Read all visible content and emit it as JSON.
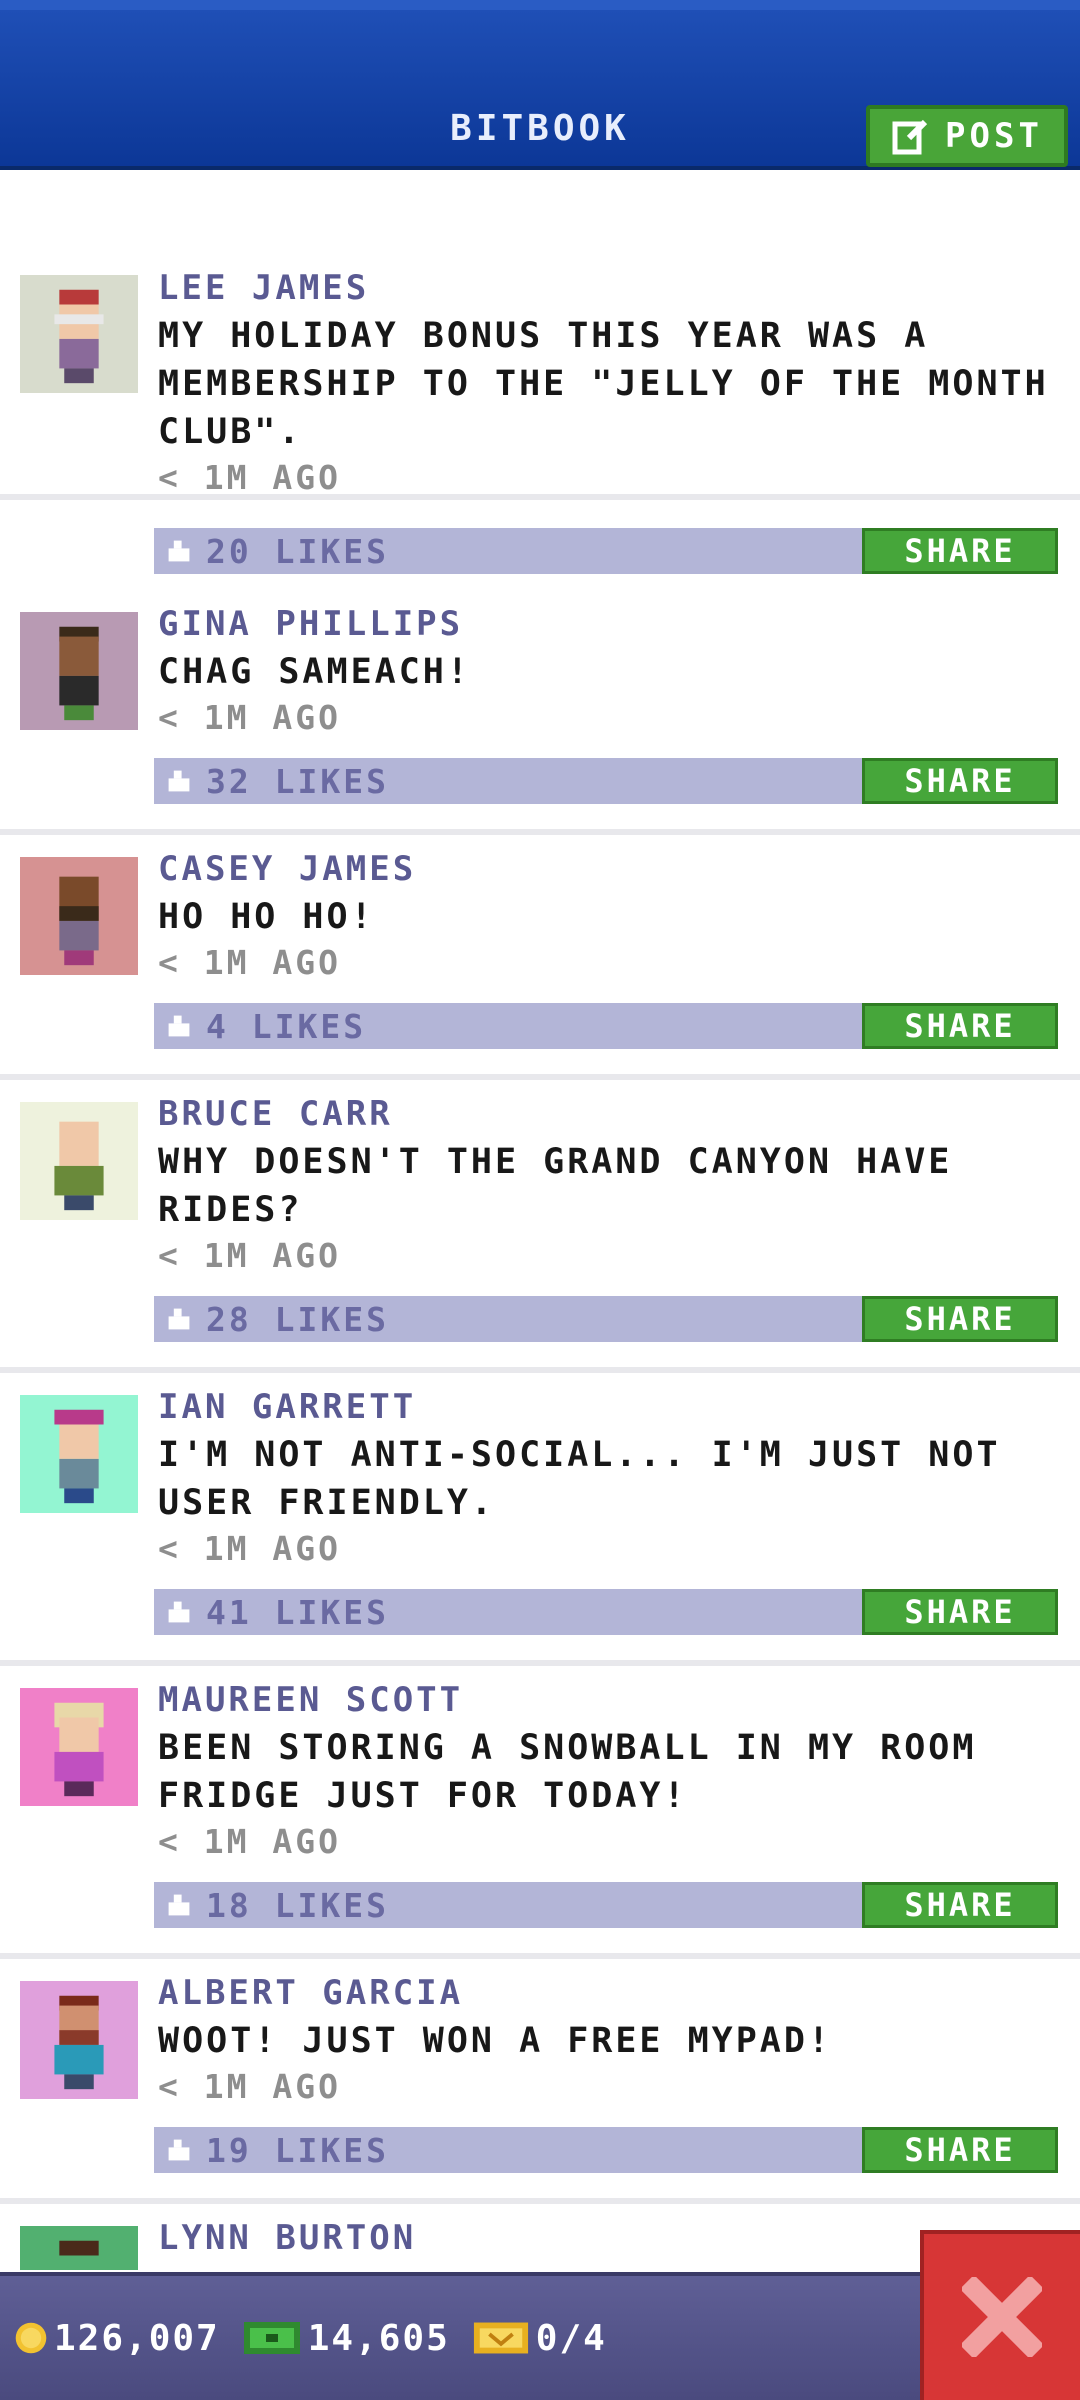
{
  "header": {
    "title": "BITBOOK",
    "post_label": "POST"
  },
  "posts": [
    {
      "name": "LEE JAMES",
      "text": "MY HOLIDAY BONUS THIS YEAR WAS A MEMBERSHIP TO THE \"JELLY OF THE MONTH CLUB\".",
      "time": "< 1M AGO",
      "likes": "20 LIKES",
      "share": "SHARE",
      "avatar_bg": "#d8dccd"
    },
    {
      "name": "GINA PHILLIPS",
      "text": "CHAG SAMEACH!",
      "time": "< 1M AGO",
      "likes": "32 LIKES",
      "share": "SHARE",
      "avatar_bg": "#b89ab3"
    },
    {
      "name": "CASEY JAMES",
      "text": "HO HO HO!",
      "time": "< 1M AGO",
      "likes": "4 LIKES",
      "share": "SHARE",
      "avatar_bg": "#d69292"
    },
    {
      "name": "BRUCE CARR",
      "text": "WHY DOESN'T THE GRAND CANYON HAVE RIDES?",
      "time": "< 1M AGO",
      "likes": "28 LIKES",
      "share": "SHARE",
      "avatar_bg": "#eef2dd"
    },
    {
      "name": "IAN GARRETT",
      "text": "I'M NOT ANTI-SOCIAL... I'M JUST NOT USER FRIENDLY.",
      "time": "< 1M AGO",
      "likes": "41 LIKES",
      "share": "SHARE",
      "avatar_bg": "#93f5d2"
    },
    {
      "name": "MAUREEN SCOTT",
      "text": "BEEN STORING A SNOWBALL IN MY ROOM FRIDGE JUST FOR TODAY!",
      "time": "< 1M AGO",
      "likes": "18 LIKES",
      "share": "SHARE",
      "avatar_bg": "#f080c8"
    },
    {
      "name": "ALBERT GARCIA",
      "text": "WOOT! JUST WON A FREE MYPAD!",
      "time": "< 1M AGO",
      "likes": "19 LIKES",
      "share": "SHARE",
      "avatar_bg": "#e0a0dc"
    },
    {
      "name": "LYNN BURTON",
      "text": "",
      "time": "",
      "likes": "",
      "share": "",
      "avatar_bg": "#52b070"
    }
  ],
  "footer": {
    "coins": "126,007",
    "cash": "14,605",
    "vip": "0/4"
  },
  "colors": {
    "header": "#1f4fb6",
    "accent_green": "#46a63a",
    "like_bar": "#b3b5d7",
    "close": "#d73636"
  },
  "icons": {
    "post": "edit-icon",
    "like": "thumbs-up-icon",
    "coin": "coin-icon",
    "cash": "bux-icon",
    "vip": "vip-ticket-icon",
    "close": "close-icon"
  }
}
